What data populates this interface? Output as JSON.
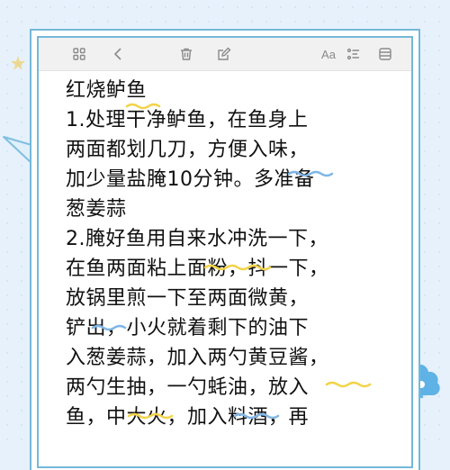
{
  "toolbar": {
    "icons": [
      "grid-icon",
      "back-icon",
      "trash-icon",
      "edit-icon",
      "font-icon",
      "list-icon",
      "more-icon"
    ],
    "font_label": "Aa"
  },
  "note": {
    "lines": [
      "红烧鲈鱼",
      "1.处理干净鲈鱼，在鱼身上",
      "两面都划几刀，方便入味，",
      "加少量盐腌10分钟。多准备",
      "葱姜蒜",
      "2.腌好鱼用自来水冲洗一下，",
      "在鱼两面粘上面粉，抖一下，",
      "放锅里煎一下至两面微黄，",
      "铲出，小火就着剩下的油下",
      "入葱姜蒜，加入两勺黄豆酱，",
      "两勺生抽，一勺蚝油，放入",
      "鱼，中大火，加入料酒，再"
    ]
  },
  "colors": {
    "background": "#e6f1fb",
    "frame": "#74b8d9",
    "highlight_yellow": "#f3d34a",
    "highlight_blue": "#7fb6e6",
    "text": "#111111"
  }
}
